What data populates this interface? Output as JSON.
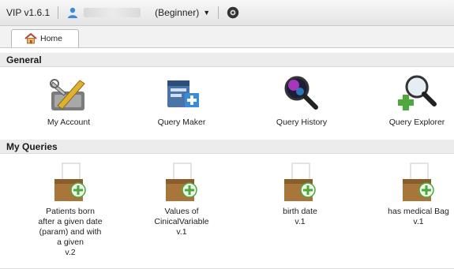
{
  "header": {
    "version": "VIP v1.6.1",
    "user_level": "(Beginner)",
    "icons": {
      "user": "user-icon",
      "dropdown": "caret-down-icon",
      "help": "help-icon"
    }
  },
  "tabs": [
    {
      "label": "Home",
      "icon": "home-icon"
    }
  ],
  "sections": {
    "general": {
      "title": "General",
      "items": [
        {
          "label": "My Account",
          "icon": "account-icon"
        },
        {
          "label": "Query Maker",
          "icon": "query-maker-icon"
        },
        {
          "label": "Query History",
          "icon": "magnifier-icon"
        },
        {
          "label": "Query Explorer",
          "icon": "explorer-icon"
        }
      ]
    },
    "queries": {
      "title": "My Queries",
      "items": [
        {
          "title": "Patients born after a given date (param) and with a given",
          "version": "v.2"
        },
        {
          "title": "Values of CinicalVariable",
          "version": "v.1"
        },
        {
          "title": "birth date",
          "version": "v.1"
        },
        {
          "title": "has medical Bag",
          "version": "v.1"
        }
      ]
    }
  },
  "colors": {
    "accent": "#3a8bd9",
    "plus_green": "#4fa83d",
    "box_brown": "#a8753a"
  }
}
